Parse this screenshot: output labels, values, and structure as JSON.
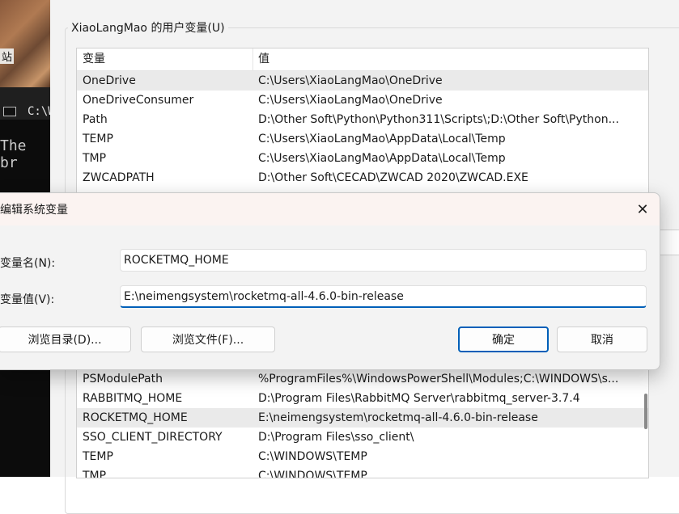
{
  "background": {
    "photo_label": "站",
    "terminal_title": "C:\\W",
    "terminal_text": "The br"
  },
  "user_vars": {
    "group_label": "XiaoLangMao 的用户变量(U)",
    "columns": [
      "变量",
      "值"
    ],
    "rows": [
      {
        "name": "OneDrive",
        "value": "C:\\Users\\XiaoLangMao\\OneDrive"
      },
      {
        "name": "OneDriveConsumer",
        "value": "C:\\Users\\XiaoLangMao\\OneDrive"
      },
      {
        "name": "Path",
        "value": "D:\\Other Soft\\Python\\Python311\\Scripts\\;D:\\Other Soft\\Python..."
      },
      {
        "name": "TEMP",
        "value": "C:\\Users\\XiaoLangMao\\AppData\\Local\\Temp"
      },
      {
        "name": "TMP",
        "value": "C:\\Users\\XiaoLangMao\\AppData\\Local\\Temp"
      },
      {
        "name": "ZWCADPATH",
        "value": "D:\\Other Soft\\CECAD\\ZWCAD 2020\\ZWCAD.EXE"
      }
    ]
  },
  "system_vars": {
    "rows": [
      {
        "name": "PSModulePath",
        "value": "%ProgramFiles%\\WindowsPowerShell\\Modules;C:\\WINDOWS\\s..."
      },
      {
        "name": "RABBITMQ_HOME",
        "value": "D:\\Program Files\\RabbitMQ Server\\rabbitmq_server-3.7.4"
      },
      {
        "name": "ROCKETMQ_HOME",
        "value": "E:\\neimengsystem\\rocketmq-all-4.6.0-bin-release"
      },
      {
        "name": "SSO_CLIENT_DIRECTORY",
        "value": "D:\\Program Files\\sso_client\\"
      },
      {
        "name": "TEMP",
        "value": "C:\\WINDOWS\\TEMP"
      },
      {
        "name": "TMP",
        "value": "C:\\WINDOWS\\TEMP"
      }
    ]
  },
  "dialog": {
    "title": "编辑系统变量",
    "name_label": "变量名(N):",
    "name_value": "ROCKETMQ_HOME",
    "value_label": "变量值(V):",
    "value_value": "E:\\neimengsystem\\rocketmq-all-4.6.0-bin-release",
    "browse_dir_label": "浏览目录(D)...",
    "browse_file_label": "浏览文件(F)...",
    "ok_label": "确定",
    "cancel_label": "取消",
    "close_icon": "close-icon"
  },
  "colors": {
    "accent": "#005fb8",
    "window_bg": "#f3f3f3",
    "title_bar": "#fbf3f1"
  }
}
